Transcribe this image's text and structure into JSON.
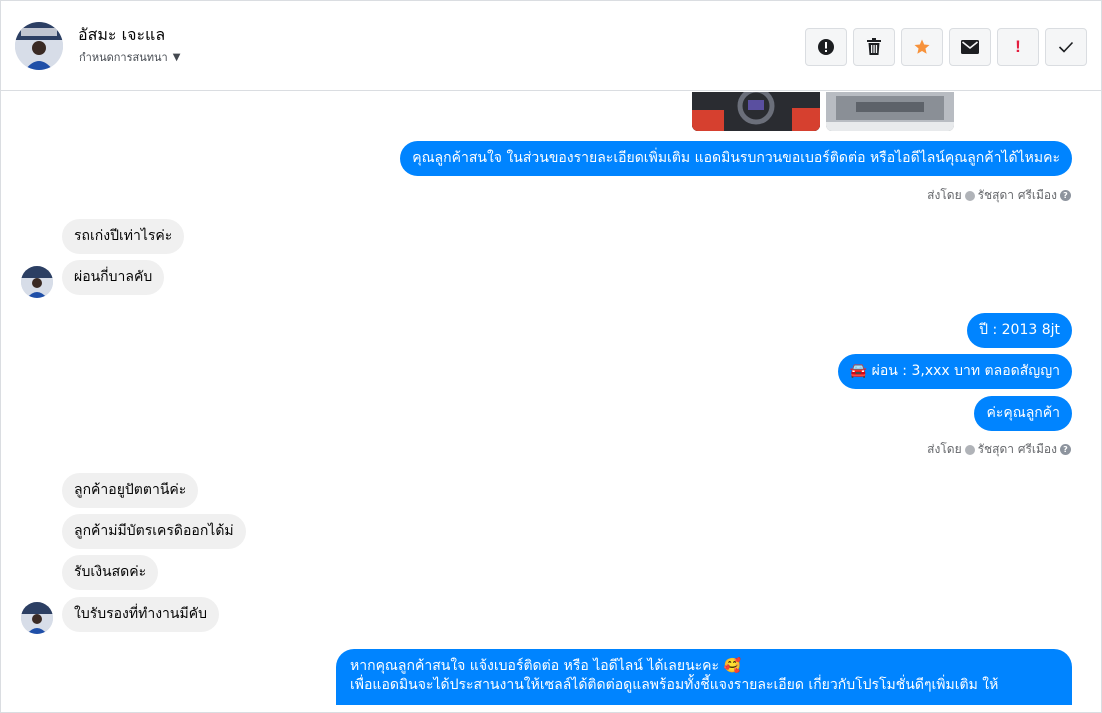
{
  "header": {
    "contact_name": "อัสมะ เจะแล",
    "assign_label": "กำหนดการสนทนา",
    "actions": [
      {
        "name": "report-icon",
        "label": "report"
      },
      {
        "name": "trash-icon",
        "label": "delete"
      },
      {
        "name": "star-icon",
        "label": "star"
      },
      {
        "name": "envelope-icon",
        "label": "mark-unread"
      },
      {
        "name": "exclamation-icon",
        "label": "!"
      },
      {
        "name": "checkmark-icon",
        "label": "done"
      }
    ]
  },
  "colors": {
    "outgoing_bubble": "#0084ff",
    "incoming_bubble": "#f0f0f0",
    "star": "#f7923b",
    "alert": "#e41e3f"
  },
  "messages": {
    "m1": "คุณลูกค้าสนใจ ในส่วนของรายละเอียดเพิ่มเติม แอดมินรบกวนขอเบอร์ติดต่อ หรือไอดีไลน์คุณลูกค้าได้ไหมคะ",
    "sent_by_1": {
      "prefix": "ส่งโดย",
      "agent": "รัชสุดา ศรีเมือง"
    },
    "m2": "รถเก่งปีเท่าไรค่ะ",
    "m3": "ผ่อนกี่บาลคับ",
    "m4": "ปี : 2013   8jt",
    "m5": "🚘 ผ่อน : 3,xxx บาท ตลอดสัญญา",
    "m6": "ค่ะคุณลูกค้า",
    "sent_by_2": {
      "prefix": "ส่งโดย",
      "agent": "รัชสุดา ศรีเมือง"
    },
    "m7": "ลูกค้าอยูปัตตานีค่ะ",
    "m8": "ลูกค้าม่มีบัตรเครดิออกได้ม่",
    "m9": "รับเงินสดค่ะ",
    "m10": "ใบรับรองที่ทำงานมีคับ",
    "m11_line1": "หากคุณลูกค้าสนใจ แจ้งเบอร์ติดต่อ หรือ ไอดีไลน์ ได้เลยนะคะ 🥰",
    "m11_line2": "เพื่อแอดมินจะได้ประสานงานให้เซลล์ได้ติดต่อดูแลพร้อมทั้งชี้แจงรายละเอียด เกี่ยวกับโปรโมชั่นดีๆเพิ่มเติม ให้"
  }
}
